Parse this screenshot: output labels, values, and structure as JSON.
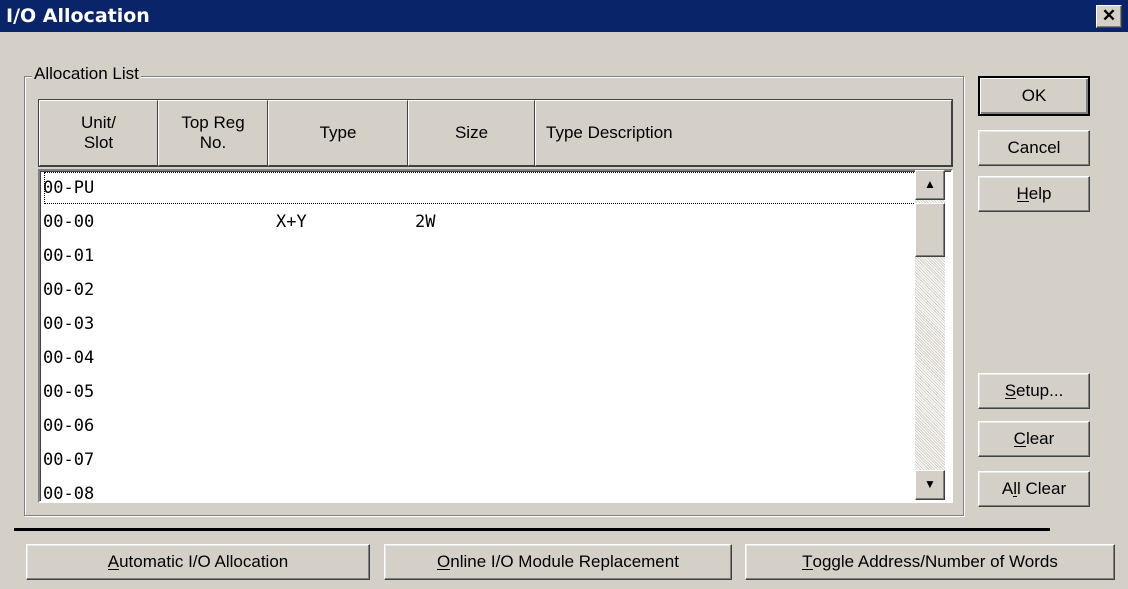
{
  "window": {
    "title": "I/O Allocation",
    "close_glyph": "✕"
  },
  "group_label": "Allocation List",
  "columns": [
    "Unit/\nSlot",
    "Top Reg\nNo.",
    "Type",
    "Size",
    "Type Description"
  ],
  "rows": [
    {
      "slot": "00-PU",
      "top_reg": "",
      "type": "",
      "size": "",
      "desc": ""
    },
    {
      "slot": "00-00",
      "top_reg": "",
      "type": "X+Y",
      "size": "2W",
      "desc": ""
    },
    {
      "slot": "00-01",
      "top_reg": "",
      "type": "",
      "size": "",
      "desc": ""
    },
    {
      "slot": "00-02",
      "top_reg": "",
      "type": "",
      "size": "",
      "desc": ""
    },
    {
      "slot": "00-03",
      "top_reg": "",
      "type": "",
      "size": "",
      "desc": ""
    },
    {
      "slot": "00-04",
      "top_reg": "",
      "type": "",
      "size": "",
      "desc": ""
    },
    {
      "slot": "00-05",
      "top_reg": "",
      "type": "",
      "size": "",
      "desc": ""
    },
    {
      "slot": "00-06",
      "top_reg": "",
      "type": "",
      "size": "",
      "desc": ""
    },
    {
      "slot": "00-07",
      "top_reg": "",
      "type": "",
      "size": "",
      "desc": ""
    },
    {
      "slot": "00-08",
      "top_reg": "",
      "type": "",
      "size": "",
      "desc": ""
    }
  ],
  "buttons": {
    "ok": "OK",
    "cancel": "Cancel",
    "help": {
      "pre": "",
      "u": "H",
      "post": "elp"
    },
    "setup": {
      "pre": "",
      "u": "S",
      "post": "etup..."
    },
    "clear": {
      "pre": "",
      "u": "C",
      "post": "lear"
    },
    "all_clear": {
      "pre": "A",
      "u": "l",
      "post": "l Clear"
    },
    "auto_alloc": {
      "pre": "",
      "u": "A",
      "post": "utomatic I/O Allocation"
    },
    "online_replace": {
      "pre": "",
      "u": "O",
      "post": "nline I/O Module Replacement"
    },
    "toggle": {
      "pre": "",
      "u": "T",
      "post": "oggle Address/Number of Words"
    }
  },
  "scrollbar": {
    "up_glyph": "▲",
    "down_glyph": "▼"
  },
  "colors": {
    "titlebar": "#0a246a",
    "face": "#d4d0c8"
  }
}
